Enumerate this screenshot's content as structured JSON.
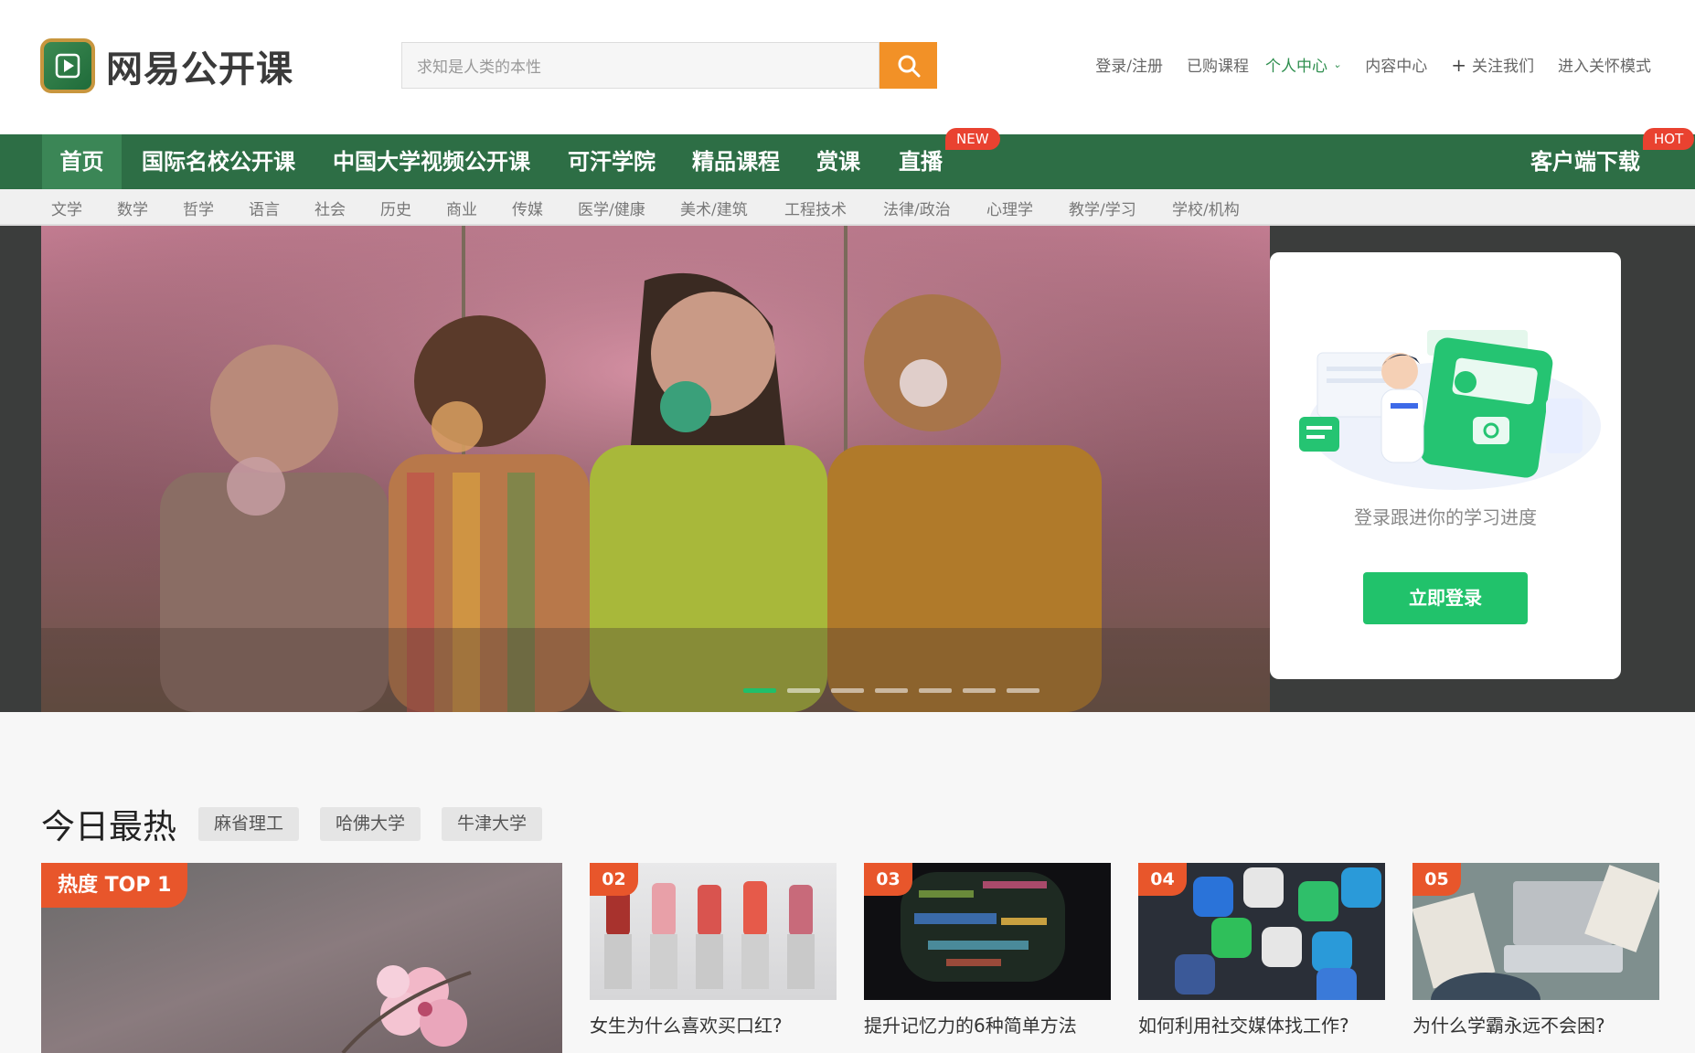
{
  "header": {
    "logo_text": "网易公开课",
    "search_placeholder": "求知是人类的本性",
    "links": {
      "login": "登录/注册",
      "purchased": "已购课程",
      "personal": "个人中心",
      "content": "内容中心",
      "follow": "关注我们",
      "care_mode": "进入关怀模式"
    }
  },
  "mainnav": {
    "items": [
      "首页",
      "国际名校公开课",
      "中国大学视频公开课",
      "可汗学院",
      "精品课程",
      "赏课",
      "直播"
    ],
    "new_badge": "NEW",
    "download": "客户端下载",
    "hot_badge": "HOT"
  },
  "subnav": [
    "文学",
    "数学",
    "哲学",
    "语言",
    "社会",
    "历史",
    "商业",
    "传媒",
    "医学/健康",
    "美术/建筑",
    "工程技术",
    "法律/政治",
    "心理学",
    "教学/学习",
    "学校/机构"
  ],
  "hero": {
    "login_text": "登录跟进你的学习进度",
    "login_button": "立即登录",
    "slide_count": 7,
    "active_slide": 1
  },
  "hot": {
    "title": "今日最热",
    "tags": [
      "麻省理工",
      "哈佛大学",
      "牛津大学"
    ],
    "top_badge": "热度 TOP 1",
    "cards": [
      {
        "num": "02",
        "title": "女生为什么喜欢买口红?"
      },
      {
        "num": "03",
        "title": "提升记忆力的6种简单方法"
      },
      {
        "num": "04",
        "title": "如何利用社交媒体找工作?"
      },
      {
        "num": "05",
        "title": "为什么学霸永远不会困?"
      }
    ]
  },
  "colors": {
    "brand_green": "#2d6e45",
    "accent_orange": "#f29127",
    "login_green": "#21c26b",
    "badge_red": "#e94230"
  }
}
